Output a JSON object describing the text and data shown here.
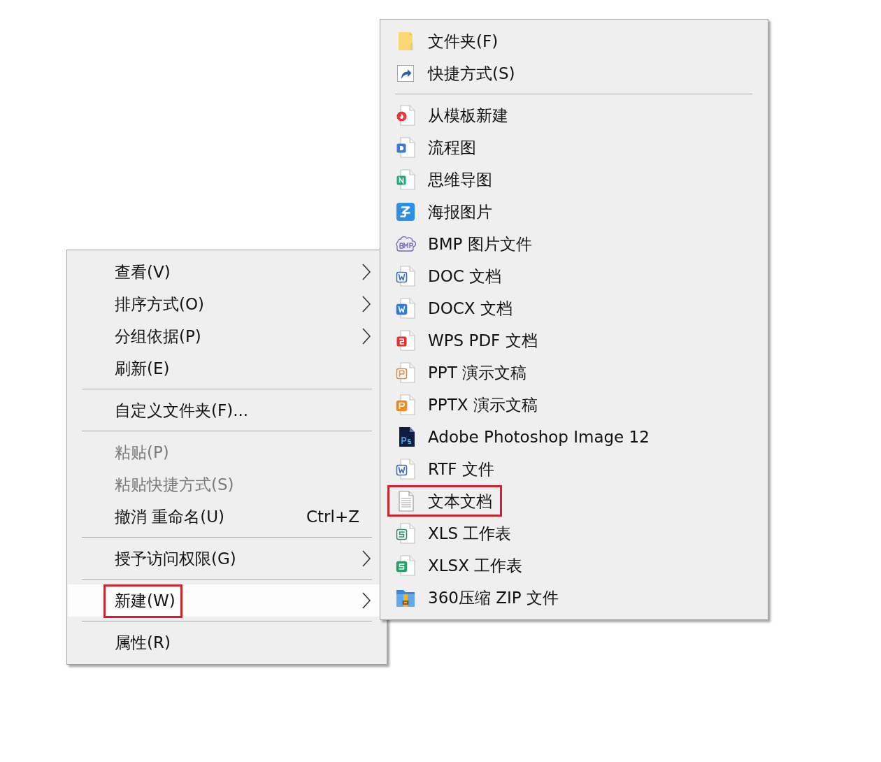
{
  "context_menu": {
    "items": [
      {
        "kind": "item",
        "label": "查看(V)",
        "submenu": true,
        "disabled": false,
        "selected": false,
        "outlined": false
      },
      {
        "kind": "item",
        "label": "排序方式(O)",
        "submenu": true,
        "disabled": false,
        "selected": false,
        "outlined": false
      },
      {
        "kind": "item",
        "label": "分组依据(P)",
        "submenu": true,
        "disabled": false,
        "selected": false,
        "outlined": false
      },
      {
        "kind": "item",
        "label": "刷新(E)",
        "submenu": false,
        "disabled": false,
        "selected": false,
        "outlined": false
      },
      {
        "kind": "separator"
      },
      {
        "kind": "item",
        "label": "自定义文件夹(F)...",
        "submenu": false,
        "disabled": false,
        "selected": false,
        "outlined": false
      },
      {
        "kind": "separator"
      },
      {
        "kind": "item",
        "label": "粘贴(P)",
        "submenu": false,
        "disabled": true,
        "selected": false,
        "outlined": false
      },
      {
        "kind": "item",
        "label": "粘贴快捷方式(S)",
        "submenu": false,
        "disabled": true,
        "selected": false,
        "outlined": false
      },
      {
        "kind": "item",
        "label": "撤消 重命名(U)",
        "shortcut": "Ctrl+Z",
        "submenu": false,
        "disabled": false,
        "selected": false,
        "outlined": false
      },
      {
        "kind": "separator"
      },
      {
        "kind": "item",
        "label": "授予访问权限(G)",
        "submenu": true,
        "disabled": false,
        "selected": false,
        "outlined": false
      },
      {
        "kind": "separator"
      },
      {
        "kind": "item",
        "label": "新建(W)",
        "submenu": true,
        "disabled": false,
        "selected": true,
        "outlined": true
      },
      {
        "kind": "separator"
      },
      {
        "kind": "item",
        "label": "属性(R)",
        "submenu": false,
        "disabled": false,
        "selected": false,
        "outlined": false
      }
    ]
  },
  "submenu": {
    "items": [
      {
        "kind": "item",
        "label": "文件夹(F)",
        "selected": false,
        "outlined": false
      },
      {
        "kind": "item",
        "label": "快捷方式(S)",
        "selected": false,
        "outlined": false
      },
      {
        "kind": "separator"
      },
      {
        "kind": "item",
        "label": "从模板新建",
        "selected": false,
        "outlined": false
      },
      {
        "kind": "item",
        "label": "流程图",
        "selected": false,
        "outlined": false
      },
      {
        "kind": "item",
        "label": "思维导图",
        "selected": false,
        "outlined": false
      },
      {
        "kind": "item",
        "label": "海报图片",
        "selected": false,
        "outlined": false
      },
      {
        "kind": "item",
        "label": "BMP 图片文件",
        "selected": false,
        "outlined": false
      },
      {
        "kind": "item",
        "label": "DOC 文档",
        "selected": false,
        "outlined": false
      },
      {
        "kind": "item",
        "label": "DOCX 文档",
        "selected": false,
        "outlined": false
      },
      {
        "kind": "item",
        "label": "WPS PDF 文档",
        "selected": false,
        "outlined": false
      },
      {
        "kind": "item",
        "label": "PPT 演示文稿",
        "selected": false,
        "outlined": false
      },
      {
        "kind": "item",
        "label": "PPTX 演示文稿",
        "selected": false,
        "outlined": false
      },
      {
        "kind": "item",
        "label": "Adobe Photoshop Image 12",
        "selected": false,
        "outlined": false
      },
      {
        "kind": "item",
        "label": "RTF 文件",
        "selected": false,
        "outlined": false
      },
      {
        "kind": "item",
        "label": "文本文档",
        "selected": false,
        "outlined": true
      },
      {
        "kind": "item",
        "label": "XLS 工作表",
        "selected": false,
        "outlined": false
      },
      {
        "kind": "item",
        "label": "XLSX 工作表",
        "selected": false,
        "outlined": false
      },
      {
        "kind": "item",
        "label": "360压缩 ZIP 文件",
        "selected": false,
        "outlined": false
      }
    ]
  }
}
